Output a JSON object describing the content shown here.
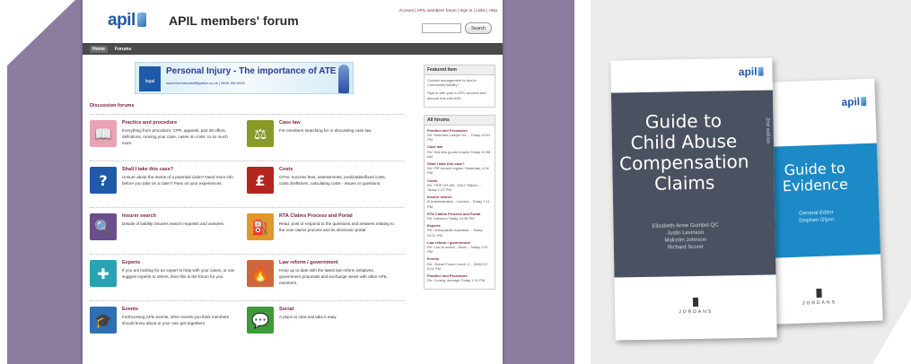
{
  "site": {
    "logo_text": "apil",
    "title": "APIL members' forum",
    "top_links": "Account | APIL members' forum | Sign in | Links | Help",
    "search_button": "Search",
    "nav": [
      "Home",
      "Forums"
    ],
    "banner": {
      "badge": "legal",
      "title": "Personal Injury - The importance of ATE",
      "subtitle": "www.therealcostoflitigation.co.uk | 0845 186 6000"
    },
    "section_title": "Discussion forums",
    "forums": [
      {
        "title": "Practice and procedure",
        "desc": "Everything from procedure, CPR, appeals, part 36 offers, definitions, running your case, cases on costs, to so much more.",
        "icon": "book-icon",
        "color": "#e8a3b4",
        "glyph": "📖"
      },
      {
        "title": "Case law",
        "desc": "For members searching for or discussing case law.",
        "icon": "scales-icon",
        "color": "#8a9a2a",
        "glyph": "⚖"
      },
      {
        "title": "Shall I take this case?",
        "desc": "Unsure about the merits of a potential claim? Need more info before you take on a claim? Pass on your experiences.",
        "icon": "question-icon",
        "color": "#1f5aa8",
        "glyph": "?"
      },
      {
        "title": "Costs",
        "desc": "CFAs, success fees, assessments, predictable/fixed costs, costs draftsmen, calculating costs - issues or questions.",
        "icon": "pound-icon",
        "color": "#b3261e",
        "glyph": "£"
      },
      {
        "title": "Insurer search",
        "desc": "Details of liability insurers search requests and answers.",
        "icon": "magnifier-icon",
        "color": "#6b4f8c",
        "glyph": "🔍"
      },
      {
        "title": "RTA Claims Process and Portal",
        "desc": "Read, post or respond to the questions and answers relating to the new claims process and its electronic portal.",
        "icon": "road-icon",
        "color": "#e0982a",
        "glyph": "⛽"
      },
      {
        "title": "Experts",
        "desc": "If you are looking for an expert to help with your cases, or can suggest experts to others, then this is the forum for you.",
        "icon": "puzzle-icon",
        "color": "#27a3b3",
        "glyph": "✚"
      },
      {
        "title": "Law reform / government",
        "desc": "Keep up to date with the latest law reform initiatives, government proposals and exchange views with other APIL members.",
        "icon": "bottle-icon",
        "color": "#d0673c",
        "glyph": "🔥"
      },
      {
        "title": "Events",
        "desc": "Forthcoming APIL events, other events you think members should know about or your own get-togethers.",
        "icon": "graduation-cap-icon",
        "color": "#2f6fb3",
        "glyph": "🎓"
      },
      {
        "title": "Social",
        "desc": "A place to chat and take it easy.",
        "icon": "chat-icon",
        "color": "#3f9a3a",
        "glyph": "💬"
      }
    ],
    "featured": {
      "title": "Featured item",
      "items": [
        "Contact management is vital in Community liability?",
        "Sign in with your e-APIL account and discuss this with APIL"
      ]
    },
    "all_forums": {
      "title": "All forums",
      "items": [
        {
          "title": "Practice and Procedure",
          "meta": "Re: Detected Lawyer for ... Today 10:51 PM"
        },
        {
          "title": "Case law",
          "meta": "Re: Helmets goods moped Today 10:58 AM"
        },
        {
          "title": "Shall I take this case?",
          "meta": "Re: PIP breach regime Yesterday, 4:04 PM"
        },
        {
          "title": "Costs",
          "meta": "Re: TRIP CR AEL ONLY SMALL... Today 1:22 PM"
        },
        {
          "title": "Insurer search",
          "meta": "Ill Administration - London... Today 1:11 PM"
        },
        {
          "title": "RTA Claims Process and Portal",
          "meta": "Re: Intention Today 04:08 PM"
        },
        {
          "title": "Experts",
          "meta": "Re: Orthopaedic expertise... Today 03:11 PM"
        },
        {
          "title": "Law reform / government",
          "meta": "Re: Law to action - Rack... Today 1:02 PM"
        },
        {
          "title": "Events",
          "meta": "Re: Global Forum Lunch 2... 26/02/12 5:51 PM"
        },
        {
          "title": "Practice and Procedure",
          "meta": "Re: Consig, damage Today 1:41 PM"
        }
      ]
    }
  },
  "books": {
    "book1": {
      "logo_text": "apil",
      "title_lines": [
        "Guide to",
        "Child Abuse",
        "Compensation",
        "Claims"
      ],
      "edition": "2nd edition",
      "authors": [
        "Elizabeth-Anne Gumbel QC",
        "Justin Levinson",
        "Malcolm Johnson",
        "Richard Scorer"
      ],
      "publisher": "JORDANS"
    },
    "book2": {
      "logo_text": "apil",
      "title_lines": [
        "Guide to",
        "Evidence"
      ],
      "credit": [
        "General Editor",
        "Stephen Glynn"
      ],
      "publisher": "JORDANS"
    }
  },
  "colors": {
    "purple": "#8c7ca0",
    "maroon": "#7a1e3f",
    "apil_blue": "#1f5aa8",
    "book1_panel": "#4a5160",
    "book2_panel": "#1b8ac7"
  }
}
